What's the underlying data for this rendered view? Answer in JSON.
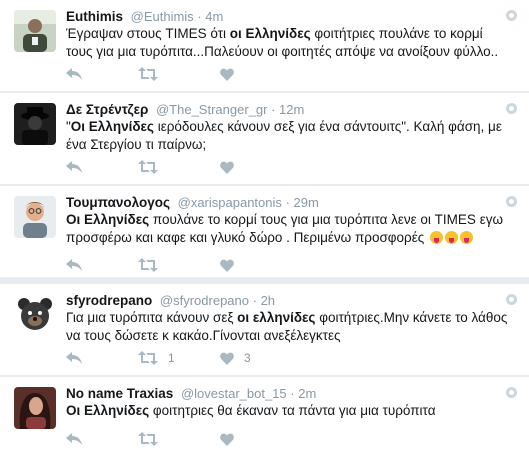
{
  "tweets": [
    {
      "fullname": "Euthimis",
      "handle": "@Euthimis",
      "sep": "·",
      "time": "4m",
      "text_parts": [
        "Έγραψαν στους TIMES ότι ",
        "οι Ελληνίδες",
        " φοιτήτριες πουλάνε το κορμί τους για μια τυρόπιτα...Παλεύουν οι φοιτητές απόψε να ανοίξουν φύλλο.."
      ],
      "retweets": "",
      "likes": ""
    },
    {
      "fullname": "Δε Στρέντζερ",
      "handle": "@The_Stranger_gr",
      "sep": "·",
      "time": "12m",
      "text_parts": [
        "\"",
        "Οι Ελληνίδες",
        " ιερόδουλες κάνουν σεξ για ένα σάντουιτς\". Καλή φάση, με ένα Στεργίου τι παίρνω;"
      ],
      "retweets": "",
      "likes": ""
    },
    {
      "fullname": "Τουμπανολογος",
      "handle": "@xarispapantonis",
      "sep": "·",
      "time": "29m",
      "text_parts": [
        "",
        "Οι Ελληνίδες",
        " πουλάνε το κορμί τους για μια τυρόπιτα λενε οι TIMES εγω προσφέρω και καφε και γλυκό δώρο . Περιμένω προσφορές "
      ],
      "emojis": [
        "tongue-wink-emoji",
        "tongue-wink-emoji",
        "tongue-wink-emoji"
      ],
      "retweets": "",
      "likes": ""
    },
    {
      "fullname": "sfyrodrepano",
      "handle": "@sfyrodrepano",
      "sep": "·",
      "time": "2h",
      "text_parts": [
        "Για μια τυρόπιτα κάνουν σεξ ",
        "οι ελληνίδες",
        " φοιτήτριες.Μην κάνετε το λάθος να τους δώσετε κ κακάο.Γίνονται ανεξέλεγκτες"
      ],
      "retweets": "1",
      "likes": "3"
    },
    {
      "fullname": "No name Traxias",
      "handle": "@lovestar_bot_15",
      "sep": "·",
      "time": "2m",
      "text_parts": [
        "",
        "Οι Ελληνίδες",
        " φοιτητριες θα έκαναν τα πάντα για μια τυρόπιτα"
      ],
      "retweets": "",
      "likes": ""
    }
  ],
  "colors": {
    "background": "#e6ecf0",
    "card": "#ffffff",
    "meta_text": "#8899a6",
    "action_icon": "#aab8c2"
  },
  "icons": {
    "reply": "reply-icon",
    "retweet": "retweet-icon",
    "like": "heart-icon",
    "more": "dropdown-caret-icon"
  }
}
